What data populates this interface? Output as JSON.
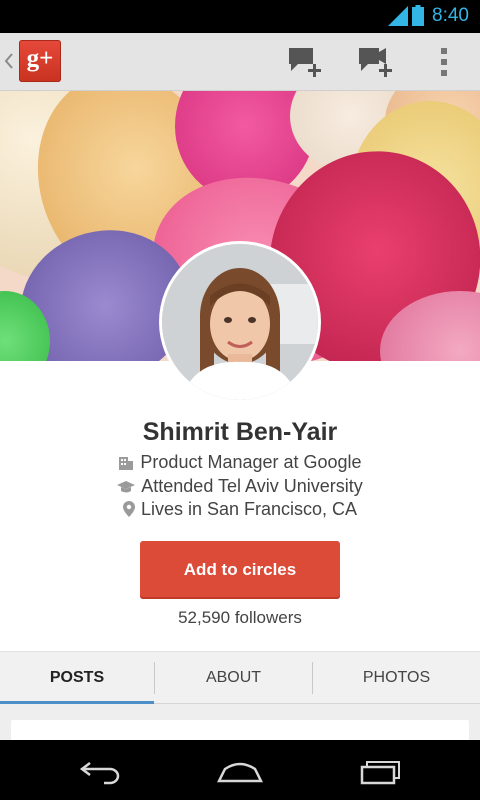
{
  "status_bar": {
    "time": "8:40",
    "icons": [
      "signal-icon",
      "battery-icon"
    ],
    "accent_color": "#33b5e5"
  },
  "action_bar": {
    "app_logo_text": "g+",
    "icons": [
      "up-caret-icon",
      "google-plus-logo",
      "add-message-icon",
      "hangout-icon",
      "overflow-menu-icon"
    ],
    "logo_color": "#dd4b39"
  },
  "profile": {
    "name": "Shimrit Ben-Yair",
    "work": "Product Manager at Google",
    "education": "Attended Tel Aviv University",
    "location": "Lives in San Francisco, CA",
    "add_button_label": "Add to circles",
    "followers": "52,590 followers",
    "button_color": "#dc4a38"
  },
  "tabs": [
    {
      "label": "POSTS",
      "selected": true
    },
    {
      "label": "ABOUT",
      "selected": false
    },
    {
      "label": "PHOTOS",
      "selected": false
    }
  ],
  "nav_bar": {
    "icons": [
      "back-icon",
      "home-icon",
      "recent-apps-icon"
    ]
  }
}
